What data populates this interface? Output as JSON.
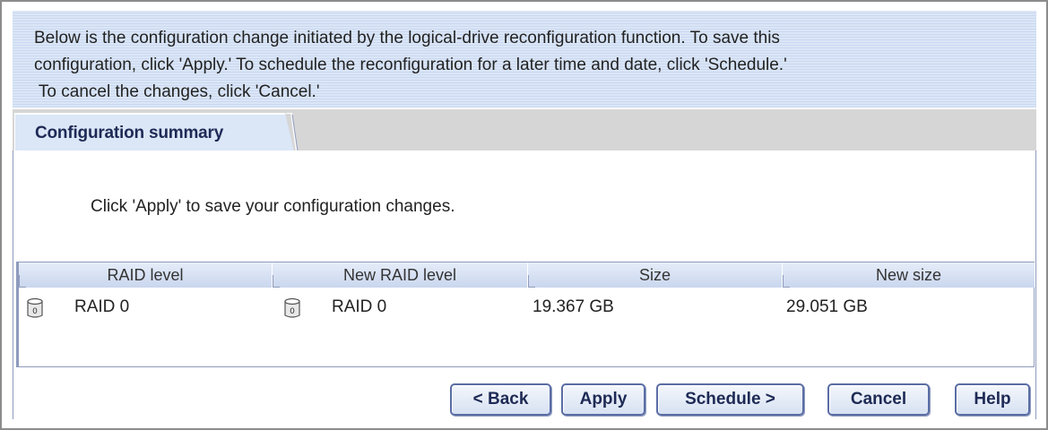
{
  "banner": {
    "line1": "Below is the configuration change initiated by the logical-drive reconfiguration function.  To save this",
    "line2": "configuration, click 'Apply.'  To schedule the reconfiguration for a later time and date, click 'Schedule.'",
    "line3": " To cancel the changes, click 'Cancel.'"
  },
  "tab": {
    "label": "Configuration summary"
  },
  "message": "Click 'Apply' to save your configuration changes.",
  "table": {
    "columns": [
      "RAID level",
      "New RAID level",
      "Size",
      "New size"
    ],
    "rows": [
      {
        "raid_level": "RAID 0",
        "raid_icon": "disk-raid0-icon",
        "new_raid_level": "RAID 0",
        "new_raid_icon": "disk-raid0-icon",
        "size": "19.367 GB",
        "new_size": "29.051 GB"
      }
    ]
  },
  "buttons": {
    "back": "< Back",
    "apply": "Apply",
    "schedule": "Schedule >",
    "cancel": "Cancel",
    "help": "Help"
  },
  "colors": {
    "banner_bg": "#dbe6f7",
    "accent": "#1e2a55",
    "border": "#8e9bbd",
    "header_bg": "#c9d6ee"
  }
}
